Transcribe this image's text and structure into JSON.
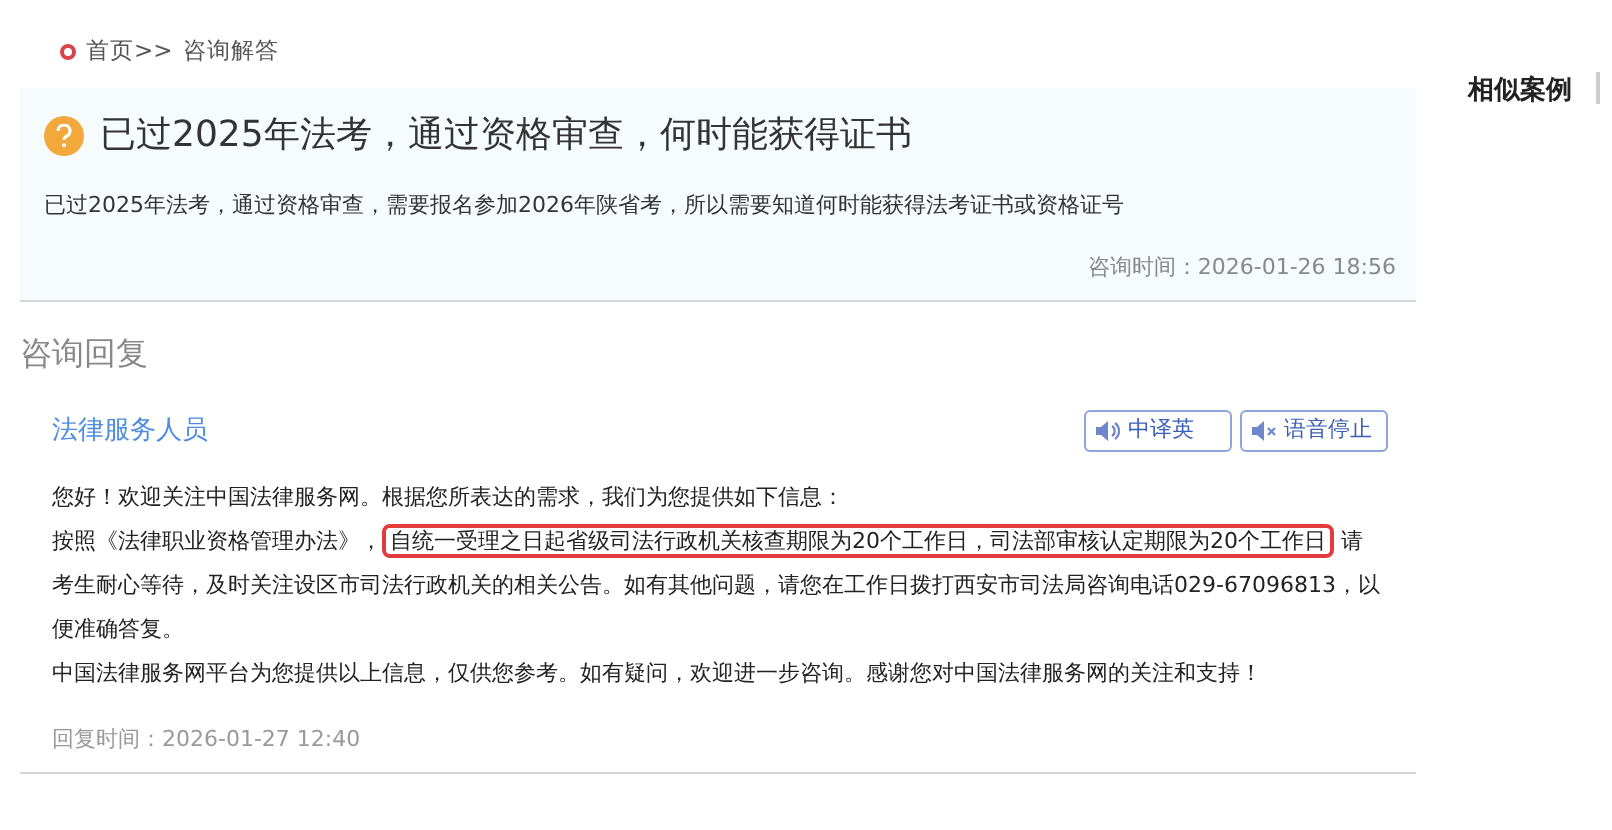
{
  "breadcrumb": {
    "items": [
      "首页>>",
      "咨询解答"
    ]
  },
  "question": {
    "title": "已过2025年法考，通过资格审查，何时能获得证书",
    "body": "已过2025年法考，通过资格审查，需要报名参加2026年陕省考，所以需要知道何时能获得法考证书或资格证号",
    "time": "咨询时间：2026-01-26 18:56"
  },
  "reply_section": {
    "heading": "咨询回复",
    "author": "法律服务人员",
    "buttons": [
      {
        "kind": "speak",
        "label": "中译英"
      },
      {
        "kind": "mute",
        "label": "语音停止"
      }
    ],
    "paragraphs": [
      [
        {
          "text": "您好！欢迎关注中国法律服务网。根据您所表达的需求，我们为您提供如下信息：",
          "highlighted": false
        }
      ],
      [
        {
          "text": "按照《法律职业资格管理办法》，",
          "highlighted": false
        },
        {
          "text": "自统一受理之日起省级司法行政机关核查期限为20个工作日，司法部审核认定期限为20个工作日",
          "highlighted": true
        },
        {
          "text": " 请考生耐心等待，及时关注设区市司法行政机关的相关公告。如有其他问题，请您在工作日拨打西安市司法局咨询电话029-67096813，以便准确答复。",
          "highlighted": false
        }
      ],
      [
        {
          "text": "中国法律服务网平台为您提供以上信息，仅供您参考。如有疑问，欢迎进一步咨询。感谢您对中国法律服务网的关注和支持！",
          "highlighted": false
        }
      ]
    ],
    "time": "回复时间：2026-01-27 12:40"
  },
  "sidebar": {
    "heading": "相似案例"
  }
}
